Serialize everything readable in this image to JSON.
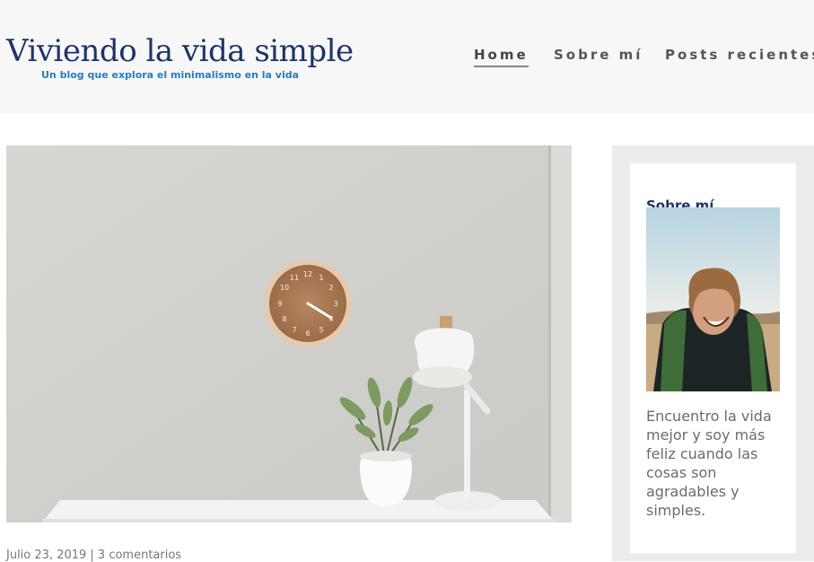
{
  "header": {
    "site_title": "Viviendo la vida simple",
    "tagline": "Un blog que explora el minimalismo en la vida"
  },
  "nav": {
    "items": [
      {
        "label": "Home",
        "active": true
      },
      {
        "label": "Sobre mí",
        "active": false
      },
      {
        "label": "Posts recientes",
        "active": false
      }
    ]
  },
  "post": {
    "image_icon": "clock-lamp-plant-photo",
    "meta": "Julio 23, 2019 | 3 comentarios"
  },
  "sidebar": {
    "title": "Sobre mí",
    "portrait_icon": "smiling-man-photo",
    "bio": "Encuentro la vida mejor y soy más feliz cuando las cosas son agradables y simples."
  },
  "colors": {
    "title": "#1c3468",
    "tagline": "#1f7fc3",
    "header_bg": "#f7f7f7",
    "sidebar_bg": "#ececec"
  }
}
